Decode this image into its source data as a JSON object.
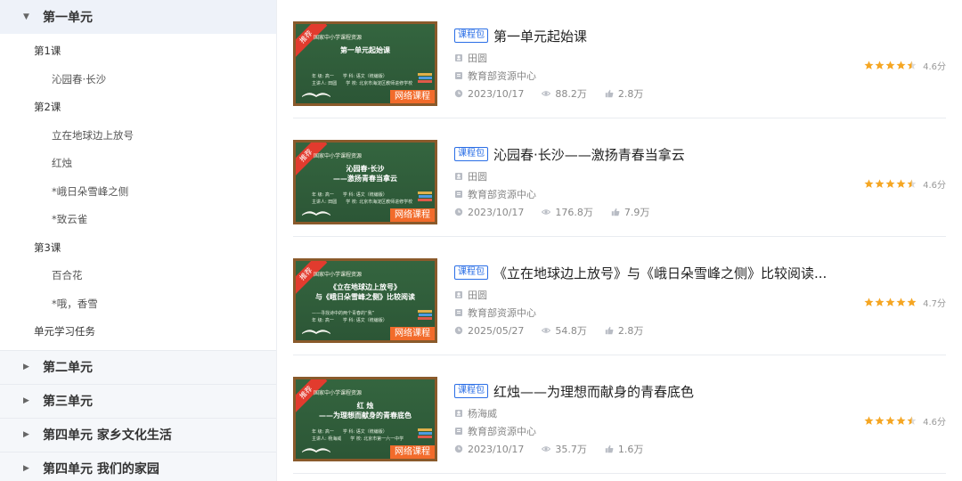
{
  "sidebar": {
    "open_unit": "第一单元",
    "lessons": [
      {
        "label": "第1课",
        "items": [
          "沁园春·长沙"
        ]
      },
      {
        "label": "第2课",
        "items": [
          "立在地球边上放号",
          "红烛",
          "*峨日朵雪峰之侧",
          "*致云雀"
        ]
      },
      {
        "label": "第3课",
        "items": [
          "百合花",
          "*哦，香雪"
        ]
      }
    ],
    "task": "单元学习任务",
    "units": [
      "第二单元",
      "第三单元",
      "第四单元 家乡文化生活",
      "第四单元 我们的家园"
    ]
  },
  "courses": [
    {
      "badge": "课程包",
      "title": "第一单元起始课",
      "author": "田圆",
      "source": "教育部资源中心",
      "date": "2023/10/17",
      "views": "88.2万",
      "likes": "2.8万",
      "rating": "4.6分",
      "stars": 4.5,
      "thumb": {
        "ribbon": "推荐",
        "header": "国家中小学课程资源",
        "main": "第一单元起始课",
        "sub": "年 级: 高一　　学 科: 语文（统编版）\n主讲人: 田圆　　学 校: 北京市海淀区教师进修学校",
        "tag": "网络课程"
      }
    },
    {
      "badge": "课程包",
      "title": "沁园春·长沙——激扬青春当拿云",
      "author": "田圆",
      "source": "教育部资源中心",
      "date": "2023/10/17",
      "views": "176.8万",
      "likes": "7.9万",
      "rating": "4.6分",
      "stars": 4.5,
      "thumb": {
        "ribbon": "推荐",
        "header": "国家中小学课程资源",
        "main": "沁园春·长沙\n——激扬青春当拿云",
        "sub": "年 级: 高一　　学 科: 语文（统编版）\n主讲人: 田圆　　学 校: 北京市海淀区教师进修学校",
        "tag": "网络课程"
      }
    },
    {
      "badge": "课程包",
      "title": "《立在地球边上放号》与《峨日朵雪峰之侧》比较阅读...",
      "author": "田圆",
      "source": "教育部资源中心",
      "date": "2025/05/27",
      "views": "54.8万",
      "likes": "2.8万",
      "rating": "4.7分",
      "stars": 5,
      "thumb": {
        "ribbon": "推荐",
        "header": "国家中小学课程资源",
        "main": "《立在地球边上放号》\n与《峨日朵雪峰之侧》比较阅读",
        "sub": "——寻找诗中的两个青春的“我”\n年 级: 高一　　学 科: 语文（统编版）",
        "tag": "网络课程"
      }
    },
    {
      "badge": "课程包",
      "title": "红烛——为理想而献身的青春底色",
      "author": "杨海威",
      "source": "教育部资源中心",
      "date": "2023/10/17",
      "views": "35.7万",
      "likes": "1.6万",
      "rating": "4.6分",
      "stars": 4.5,
      "thumb": {
        "ribbon": "推荐",
        "header": "国家中小学课程资源",
        "main": "红 烛\n——为理想而献身的青春底色",
        "sub": "年 级: 高一　　学 科: 语文（统编版）\n主讲人: 杨海威　　学 校: 北京市第一六一中学",
        "tag": "网络课程"
      }
    }
  ],
  "colors": {
    "badge": "#2a6ee6",
    "star": "#f5a623",
    "tag": "#f26b2b",
    "ribbon": "#e23b2e",
    "board": "#2f5a3a"
  }
}
